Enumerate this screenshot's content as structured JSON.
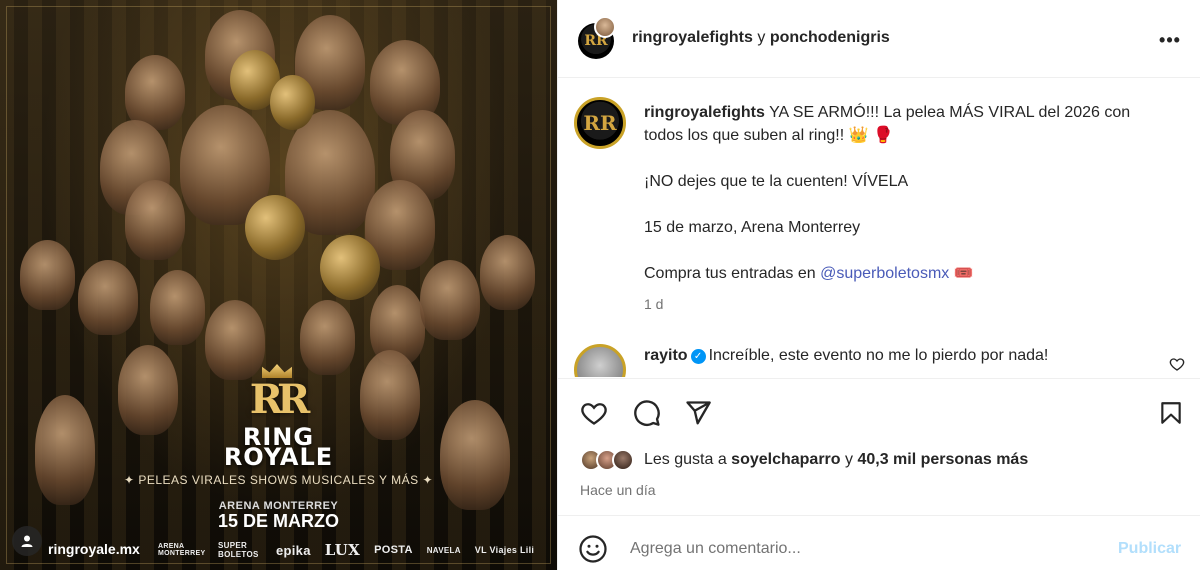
{
  "poster": {
    "title_line1": "RING",
    "title_line2": "ROYALE",
    "logo_text": "RR",
    "tagline": "✦ PELEAS VIRALES SHOWS MUSICALES Y MÁS ✦",
    "venue": "ARENA MONTERREY",
    "date": "15 DE MARZO",
    "url": "ringroyale.mx",
    "sponsors": [
      "ARENA MONTERREY",
      "SUPER BOLETOS",
      "epika",
      "LUX",
      "POSTA",
      "NAVELA",
      "VL Viajes Lili"
    ]
  },
  "header": {
    "user1": "ringroyalefights",
    "conjunction": "y",
    "user2": "ponchodenigris",
    "more_label": "•••"
  },
  "caption": {
    "username": "ringroyalefights",
    "line1": "YA SE ARMÓ!!! La pelea MÁS VIRAL del 2026 con todos los que suben al ring!! 👑 🥊",
    "line2": "¡NO dejes que te la cuenten! VÍVELA",
    "line3": "15 de marzo, Arena Monterrey",
    "line4_prefix": "Compra tus entradas en ",
    "line4_mention": "@superboletosmx",
    "line4_suffix": " 🎟️",
    "time": "1 d"
  },
  "comment": {
    "username": "rayito",
    "text": "Increíble, este evento no me lo pierdo por nada!"
  },
  "likes": {
    "prefix": "Les gusta a ",
    "user": "soyelchaparro",
    "middle": " y ",
    "count": "40,3 mil personas más",
    "posted": "Hace un día"
  },
  "add_comment": {
    "placeholder": "Agrega un comentario...",
    "publish": "Publicar"
  }
}
